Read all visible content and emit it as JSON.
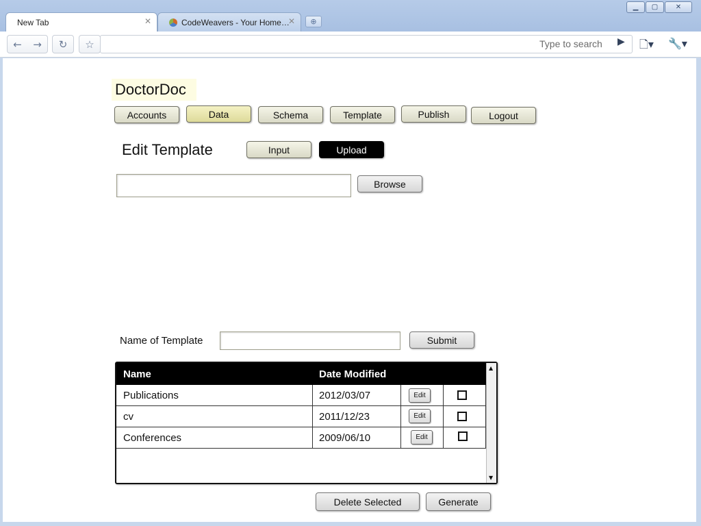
{
  "browser": {
    "tabs": [
      {
        "label": "New Tab",
        "active": true
      },
      {
        "label": "CodeWeavers - Your Home…",
        "active": false
      }
    ],
    "search_placeholder": "Type to search"
  },
  "app": {
    "title": "DoctorDoc",
    "nav": [
      "Accounts",
      "Data",
      "Schema",
      "Template",
      "Publish",
      "Logout"
    ]
  },
  "page": {
    "heading": "Edit Template",
    "modes": {
      "input": "Input",
      "upload": "Upload"
    },
    "browse_label": "Browse",
    "name_label": "Name of Template",
    "submit_label": "Submit"
  },
  "table": {
    "columns": [
      "Name",
      "Date Modified"
    ],
    "rows": [
      {
        "name": "Publications",
        "date": "2012/03/07",
        "edit": "Edit",
        "checked": false
      },
      {
        "name": "cv",
        "date": "2011/12/23",
        "edit": "Edit",
        "checked": false
      },
      {
        "name": "Conferences",
        "date": "2009/06/10",
        "edit": "Edit",
        "checked": false
      }
    ]
  },
  "actions": {
    "delete_selected": "Delete Selected",
    "generate": "Generate"
  }
}
